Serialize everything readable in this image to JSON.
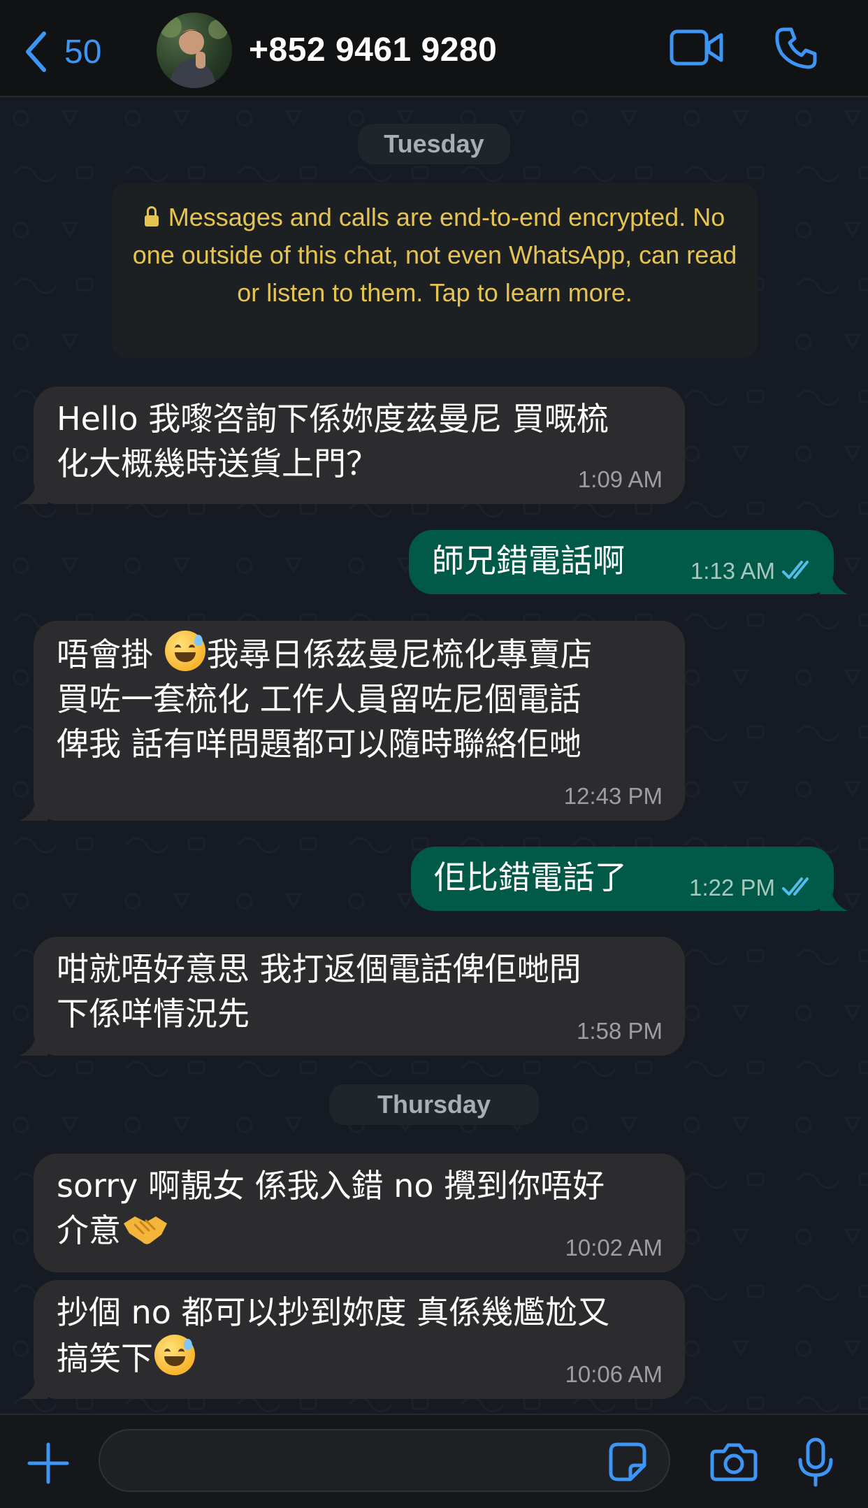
{
  "header": {
    "back_count": "50",
    "contact_name": "+852 9461 9280"
  },
  "chat": {
    "date_separators": [
      "Tuesday",
      "Thursday"
    ],
    "encryption_notice": "Messages and calls are end-to-end encrypted. No one outside of this chat, not even WhatsApp, can read or listen to them. Tap to learn more.",
    "messages": [
      {
        "direction": "incoming",
        "lines": [
          "Hello 我嚟咨詢下係妳度茲曼尼 買嘅梳",
          "化大概幾時送貨上門？"
        ],
        "time": "1:09 AM"
      },
      {
        "direction": "outgoing",
        "lines": [
          "師兄錯電話啊"
        ],
        "time": "1:13 AM",
        "status": "read"
      },
      {
        "direction": "incoming",
        "lines": [
          "唔會掛",
          "我尋日係茲曼尼梳化專賣店",
          "買咗一套梳化 工作人員留咗尼個電話",
          "俾我 話有咩問題都可以隨時聯絡佢哋"
        ],
        "time": "12:43 PM"
      },
      {
        "direction": "outgoing",
        "lines": [
          "佢比錯電話了"
        ],
        "time": "1:22 PM",
        "status": "read"
      },
      {
        "direction": "incoming",
        "lines": [
          "咁就唔好意思 我打返個電話俾佢哋問",
          "下係咩情況先"
        ],
        "time": "1:58 PM"
      },
      {
        "direction": "incoming",
        "lines": [
          "sorry 啊靚女 係我入錯 no 攪到你唔好",
          "介意"
        ],
        "time": "10:02 AM"
      },
      {
        "direction": "incoming",
        "lines": [
          "抄個 no 都可以抄到妳度 真係幾尷尬又",
          "搞笑下"
        ],
        "time": "10:06 AM"
      }
    ]
  },
  "input": {
    "placeholder": ""
  },
  "colors": {
    "accent": "#3d96f5",
    "incoming_bubble": "#2c2c2f",
    "outgoing_bubble": "#005a47",
    "encryption_text": "#e6c452",
    "read_check": "#53bdeb"
  },
  "icons": [
    "chevron-left-icon",
    "video-call-icon",
    "phone-icon",
    "plus-icon",
    "sticker-icon",
    "camera-icon",
    "microphone-icon",
    "lock-icon",
    "double-check-icon"
  ]
}
